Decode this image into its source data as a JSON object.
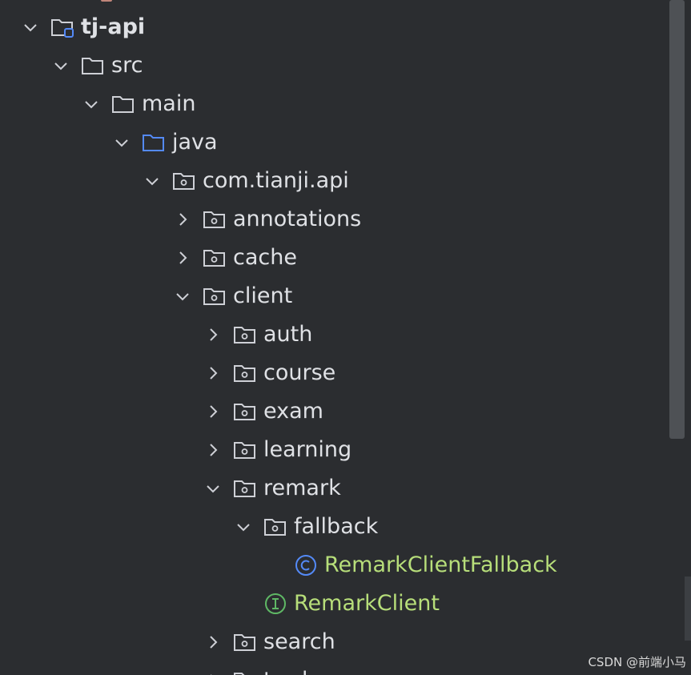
{
  "project_tree": {
    "nodes": [
      {
        "label": "tj-api",
        "expanded": true,
        "icon": "module-folder-icon"
      },
      {
        "label": "src",
        "expanded": true,
        "icon": "folder-icon"
      },
      {
        "label": "main",
        "expanded": true,
        "icon": "folder-icon"
      },
      {
        "label": "java",
        "expanded": true,
        "icon": "source-folder-icon"
      },
      {
        "label": "com.tianji.api",
        "expanded": true,
        "icon": "package-icon"
      },
      {
        "label": "annotations",
        "expanded": false,
        "icon": "package-icon"
      },
      {
        "label": "cache",
        "expanded": false,
        "icon": "package-icon"
      },
      {
        "label": "client",
        "expanded": true,
        "icon": "package-icon"
      },
      {
        "label": "auth",
        "expanded": false,
        "icon": "package-icon"
      },
      {
        "label": "course",
        "expanded": false,
        "icon": "package-icon"
      },
      {
        "label": "exam",
        "expanded": false,
        "icon": "package-icon"
      },
      {
        "label": "learning",
        "expanded": false,
        "icon": "package-icon"
      },
      {
        "label": "remark",
        "expanded": true,
        "icon": "package-icon"
      },
      {
        "label": "fallback",
        "expanded": true,
        "icon": "package-icon"
      },
      {
        "label": "RemarkClientFallback",
        "icon": "class-icon"
      },
      {
        "label": "RemarkClient",
        "icon": "interface-icon"
      },
      {
        "label": "search",
        "expanded": false,
        "icon": "package-icon"
      },
      {
        "label": "trade",
        "expanded": false,
        "icon": "package-icon"
      }
    ]
  },
  "watermark": "CSDN @前端小马",
  "colors": {
    "background": "#2b2d30",
    "text": "#dfe1e5",
    "class_text": "#b7de7a",
    "class_icon": "#548af7",
    "interface_icon": "#5fb865",
    "source_folder": "#548af7"
  }
}
